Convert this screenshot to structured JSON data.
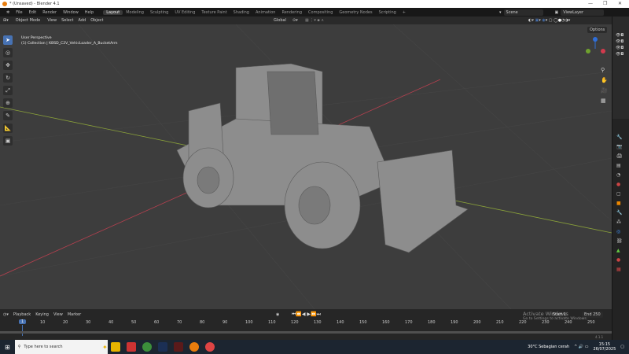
{
  "window": {
    "title": "* (Unsaved) - Blender 4.1"
  },
  "menu": [
    "File",
    "Edit",
    "Render",
    "Window",
    "Help"
  ],
  "workspaces": [
    "Layout",
    "Modeling",
    "Sculpting",
    "UV Editing",
    "Texture Paint",
    "Shading",
    "Animation",
    "Rendering",
    "Compositing",
    "Geometry Nodes",
    "Scripting",
    "+"
  ],
  "scene": {
    "scene_name": "Scene",
    "view_layer": "ViewLayer"
  },
  "header": {
    "mode": "Object Mode",
    "items": [
      "View",
      "Select",
      "Add",
      "Object"
    ],
    "orientation": "Global",
    "options": "Options"
  },
  "viewport": {
    "perspective": "User Perspective",
    "collection": "(1) Collection | KBSD_C2V_VehicLoader_A_BucketArm"
  },
  "timeline": {
    "menus": [
      "Playback",
      "Keying",
      "View",
      "Marker"
    ],
    "current_frame": "1",
    "ticks": [
      "10",
      "20",
      "30",
      "40",
      "50",
      "60",
      "70",
      "80",
      "90",
      "100",
      "110",
      "120",
      "130",
      "140",
      "150",
      "160",
      "170",
      "180",
      "190",
      "200",
      "210",
      "220",
      "230",
      "240",
      "250"
    ],
    "start_label": "Start",
    "start": "1",
    "end_label": "End",
    "end": "250",
    "version": "4.1.1"
  },
  "watermark": {
    "line1": "Activate Windows",
    "line2": "Go to Settings to activate Windows."
  },
  "taskbar": {
    "search_placeholder": "Type here to search",
    "weather": "30°C  Sebagian cerah",
    "time": "15:15",
    "date": "26/07/2025"
  },
  "colors": {
    "accent": "#4772b3",
    "viewport": "#3d3d3d",
    "x_axis": "#b5404f",
    "y_axis": "#8aa13a"
  }
}
